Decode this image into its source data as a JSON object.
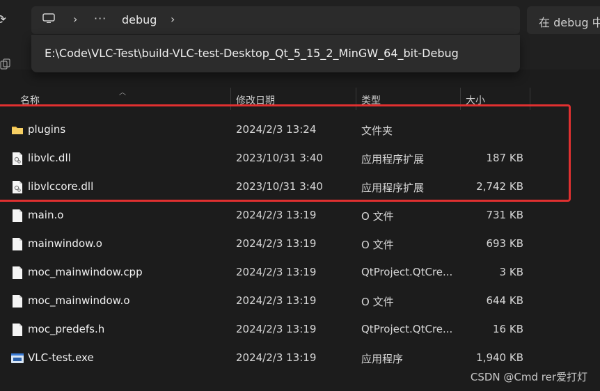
{
  "address_bar": {
    "crumb": "debug",
    "ellipsis": "···",
    "full_path": "E:\\Code\\VLC-Test\\build-VLC-test-Desktop_Qt_5_15_2_MinGW_64_bit-Debug"
  },
  "search": {
    "placeholder": "在 debug 中"
  },
  "columns": {
    "name": "名称",
    "date": "修改日期",
    "type": "类型",
    "size": "大小"
  },
  "files": [
    {
      "name": "plugins",
      "date": "2024/2/3 13:24",
      "type": "文件夹",
      "size": "",
      "icon": "folder-icon"
    },
    {
      "name": "libvlc.dll",
      "date": "2023/10/31 3:40",
      "type": "应用程序扩展",
      "size": "187 KB",
      "icon": "dll-icon"
    },
    {
      "name": "libvlccore.dll",
      "date": "2023/10/31 3:40",
      "type": "应用程序扩展",
      "size": "2,742 KB",
      "icon": "dll-icon"
    },
    {
      "name": "main.o",
      "date": "2024/2/3 13:19",
      "type": "O 文件",
      "size": "731 KB",
      "icon": "file-icon"
    },
    {
      "name": "mainwindow.o",
      "date": "2024/2/3 13:19",
      "type": "O 文件",
      "size": "693 KB",
      "icon": "file-icon"
    },
    {
      "name": "moc_mainwindow.cpp",
      "date": "2024/2/3 13:19",
      "type": "QtProject.QtCre...",
      "size": "3 KB",
      "icon": "file-icon"
    },
    {
      "name": "moc_mainwindow.o",
      "date": "2024/2/3 13:19",
      "type": "O 文件",
      "size": "644 KB",
      "icon": "file-icon"
    },
    {
      "name": "moc_predefs.h",
      "date": "2024/2/3 13:19",
      "type": "QtProject.QtCre...",
      "size": "16 KB",
      "icon": "file-icon"
    },
    {
      "name": "VLC-test.exe",
      "date": "2024/2/3 13:19",
      "type": "应用程序",
      "size": "1,940 KB",
      "icon": "exe-icon"
    }
  ],
  "watermark": "CSDN @Cmd rer爱打灯",
  "colors": {
    "background": "#1c1c1c",
    "highlight_border": "#e03030",
    "folder": "#f3c14b"
  }
}
